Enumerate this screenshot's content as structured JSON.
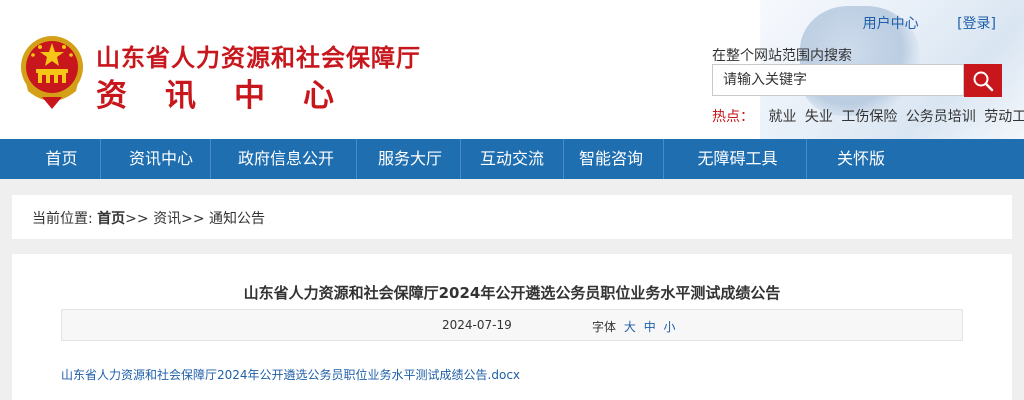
{
  "header": {
    "title": "山东省人力资源和社会保障厅",
    "subtitle": "资讯中心",
    "user_center": "用户中心",
    "login": "[登录]",
    "search_label": "在整个网站范围内搜索",
    "search_placeholder": "请输入关键字",
    "hot_label": "热点：",
    "hot_items": [
      "就业",
      "失业",
      "工伤保险",
      "公务员培训",
      "劳动工资"
    ]
  },
  "nav": {
    "items": [
      "首页",
      "资讯中心",
      "政府信息公开",
      "服务大厅",
      "互动交流",
      "智能咨询",
      "无障碍工具",
      "关怀版"
    ]
  },
  "breadcrumb": {
    "prefix": "当前位置:",
    "home": "首页",
    "rest": ">> 资讯>> 通知公告"
  },
  "article": {
    "title": "山东省人力资源和社会保障厅2024年公开遴选公务员职位业务水平测试成绩公告",
    "date": "2024-07-19",
    "font_label": "字体",
    "font_sizes": [
      "大",
      "中",
      "小"
    ],
    "attachment": "山东省人力资源和社会保障厅2024年公开遴选公务员职位业务水平测试成绩公告.docx"
  },
  "colors": {
    "brand_red": "#c8161d",
    "nav_blue": "#1e6eb0",
    "link_blue": "#1f5fa8"
  }
}
